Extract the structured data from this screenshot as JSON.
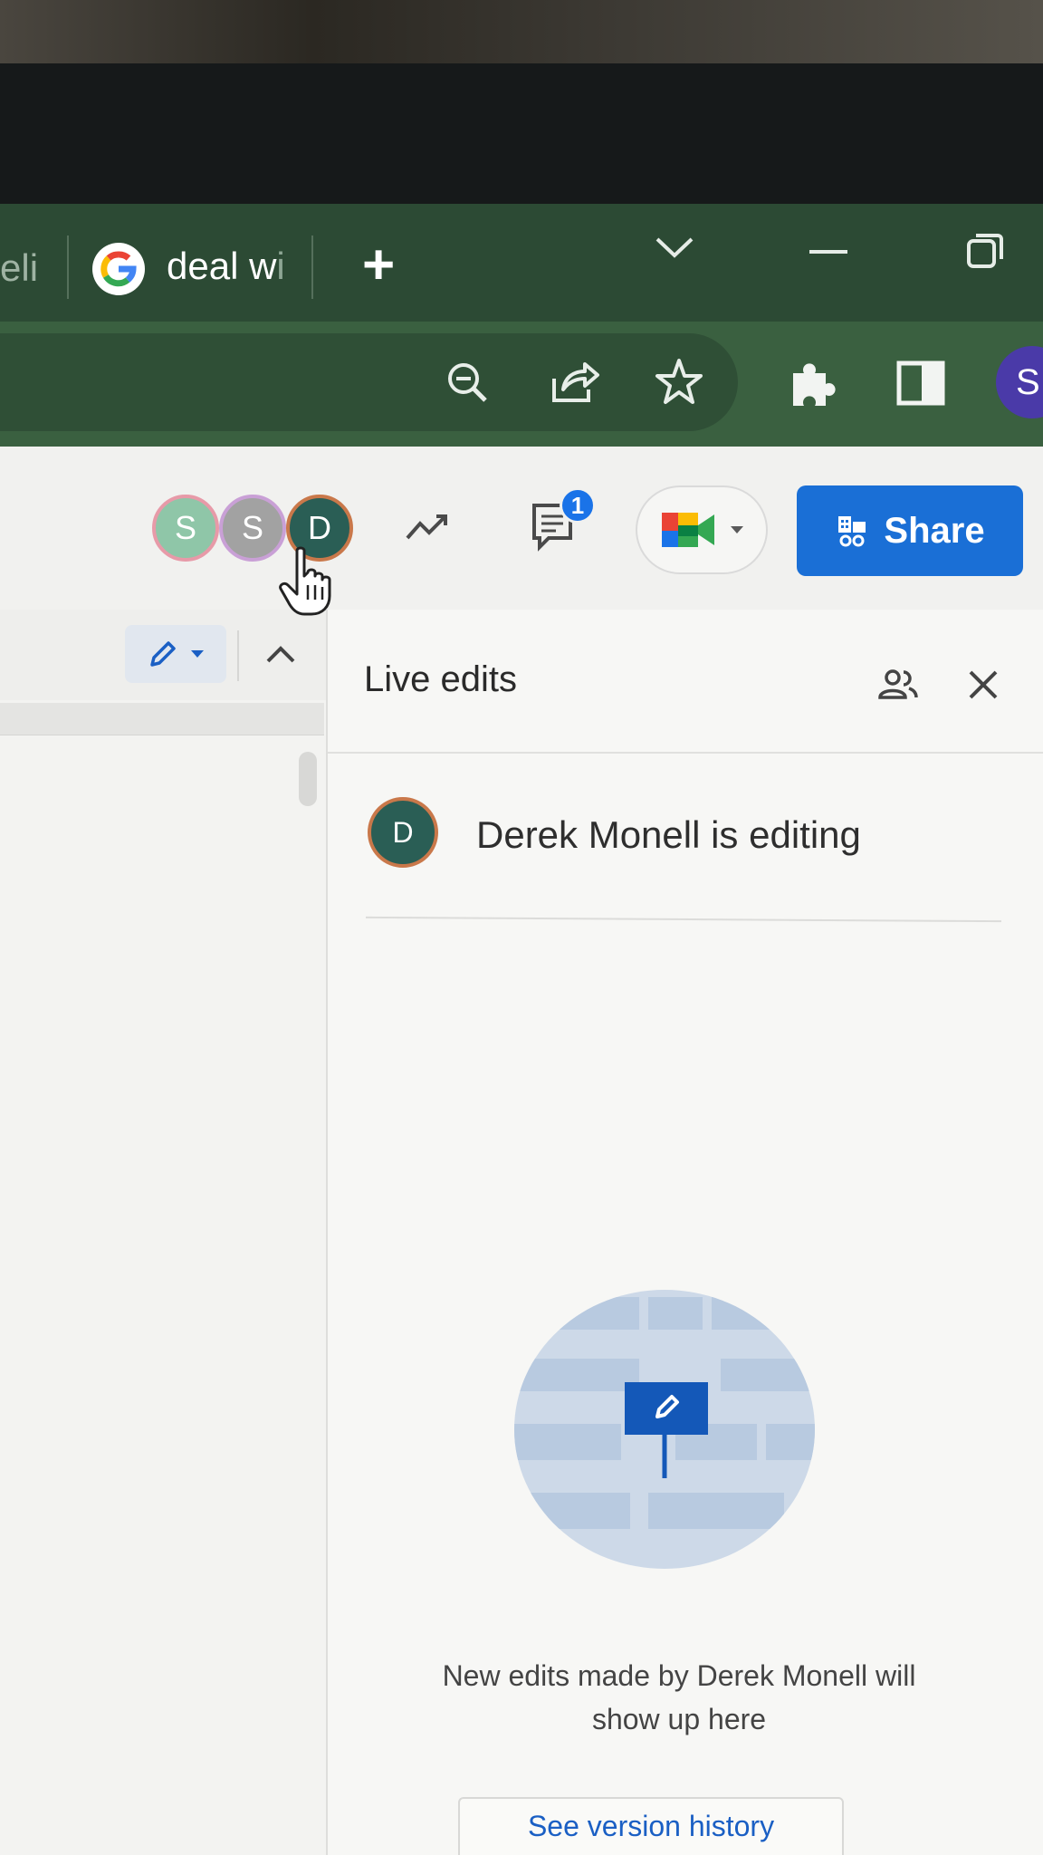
{
  "browser": {
    "prev_tab_fragment": "eli",
    "tab_title": "deal w",
    "tab_title_faded": "i",
    "new_tab_label": "+",
    "profile_initial": "S"
  },
  "header": {
    "collaborators": [
      {
        "initial": "S",
        "color": "#8fc6a8",
        "ring": "#e79aa8"
      },
      {
        "initial": "S",
        "color": "#a2a2a2",
        "ring": "#c9a0d6"
      },
      {
        "initial": "D",
        "color": "#2a5e55",
        "ring": "#c9784a"
      }
    ],
    "comment_count": "1",
    "share_label": "Share"
  },
  "panel": {
    "title": "Live edits",
    "editor_initial": "D",
    "editor_status": "Derek Monell is editing",
    "empty_message_line1": "New edits made by Derek Monell will",
    "empty_message_line2": "show up here",
    "history_button": "See version history"
  },
  "colors": {
    "share_blue": "#1a6fd6",
    "browser_green": "#2c4a34"
  }
}
